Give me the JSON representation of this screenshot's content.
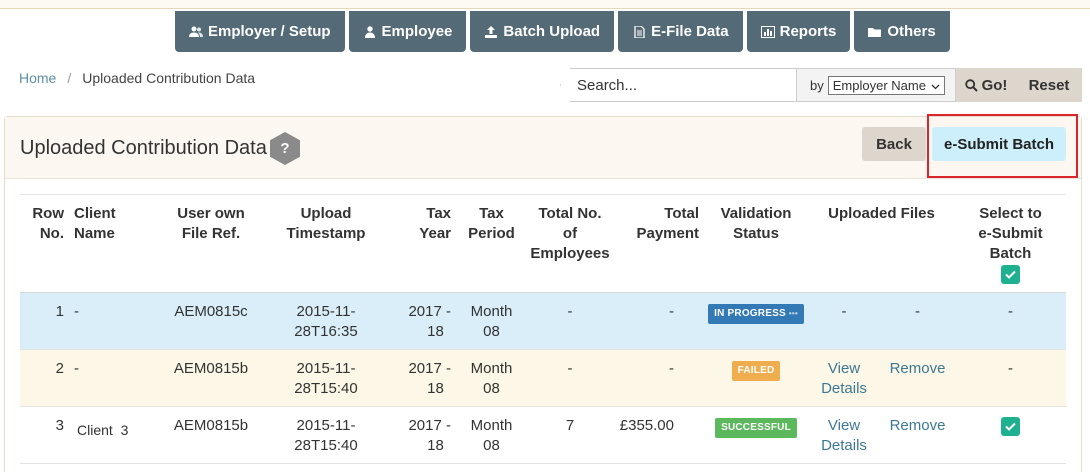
{
  "nav": {
    "items": [
      {
        "label": "Employer / Setup",
        "icon": "users-icon"
      },
      {
        "label": "Employee",
        "icon": "user-icon"
      },
      {
        "label": "Batch Upload",
        "icon": "upload-icon"
      },
      {
        "label": "E-File Data",
        "icon": "file-icon"
      },
      {
        "label": "Reports",
        "icon": "bar-chart-icon"
      },
      {
        "label": "Others",
        "icon": "folder-icon"
      }
    ]
  },
  "breadcrumb": {
    "home": "Home",
    "separator": "/",
    "current": "Uploaded Contribution Data"
  },
  "search": {
    "placeholder": "Search...",
    "by_label": "by",
    "by_selected": "Employer Name",
    "go_label": "Go!",
    "reset_label": "Reset"
  },
  "panel": {
    "title": "Uploaded Contribution Data",
    "help": "?",
    "back_label": "Back",
    "esubmit_label": "e-Submit Batch"
  },
  "table": {
    "headers": {
      "row_no": [
        "Row",
        "No."
      ],
      "client": [
        "Client",
        "Name"
      ],
      "file_ref": [
        "User own",
        "File Ref."
      ],
      "timestamp": [
        "Upload",
        "Timestamp"
      ],
      "tax_year": [
        "Tax",
        "Year"
      ],
      "tax_period": [
        "Tax",
        "Period"
      ],
      "employees": [
        "Total No.",
        "of",
        "Employees"
      ],
      "payment": [
        "Total",
        "Payment"
      ],
      "status": [
        "Validation",
        "Status"
      ],
      "files": "Uploaded Files",
      "select": [
        "Select to",
        "e-Submit",
        "Batch"
      ]
    },
    "rows": [
      {
        "row_no": "1",
        "client": "-",
        "file_ref": "AEM0815c",
        "timestamp": "2015-11-28T16:35",
        "tax_year": [
          "2017 -",
          "18"
        ],
        "tax_period": [
          "Month",
          "08"
        ],
        "employees": "-",
        "payment": "-",
        "status": "IN PROGRESS",
        "view": [
          "-"
        ],
        "remove": "-",
        "select": "-"
      },
      {
        "row_no": "2",
        "client": "-",
        "file_ref": "AEM0815b",
        "timestamp": "2015-11-28T15:40",
        "tax_year": [
          "2017 -",
          "18"
        ],
        "tax_period": [
          "Month",
          "08"
        ],
        "employees": "-",
        "payment": "-",
        "status": "FAILED",
        "view": [
          "View",
          "Details"
        ],
        "remove": "Remove",
        "select": "-"
      },
      {
        "row_no": "3",
        "client": "Client  3",
        "file_ref": "AEM0815b",
        "timestamp": "2015-11-28T15:40",
        "tax_year": [
          "2017 -",
          "18"
        ],
        "tax_period": [
          "Month",
          "08"
        ],
        "employees": "7",
        "payment": "£355.00",
        "status": "SUCCESSFUL",
        "view": [
          "View",
          "Details"
        ],
        "remove": "Remove",
        "select": "checked"
      }
    ]
  },
  "colors": {
    "nav_bg": "#546a76",
    "progress": "#3379b5",
    "failed": "#f0ad4e",
    "success": "#5cb85c",
    "checkbox": "#1fb08f",
    "highlight_frame": "#d9262c"
  }
}
